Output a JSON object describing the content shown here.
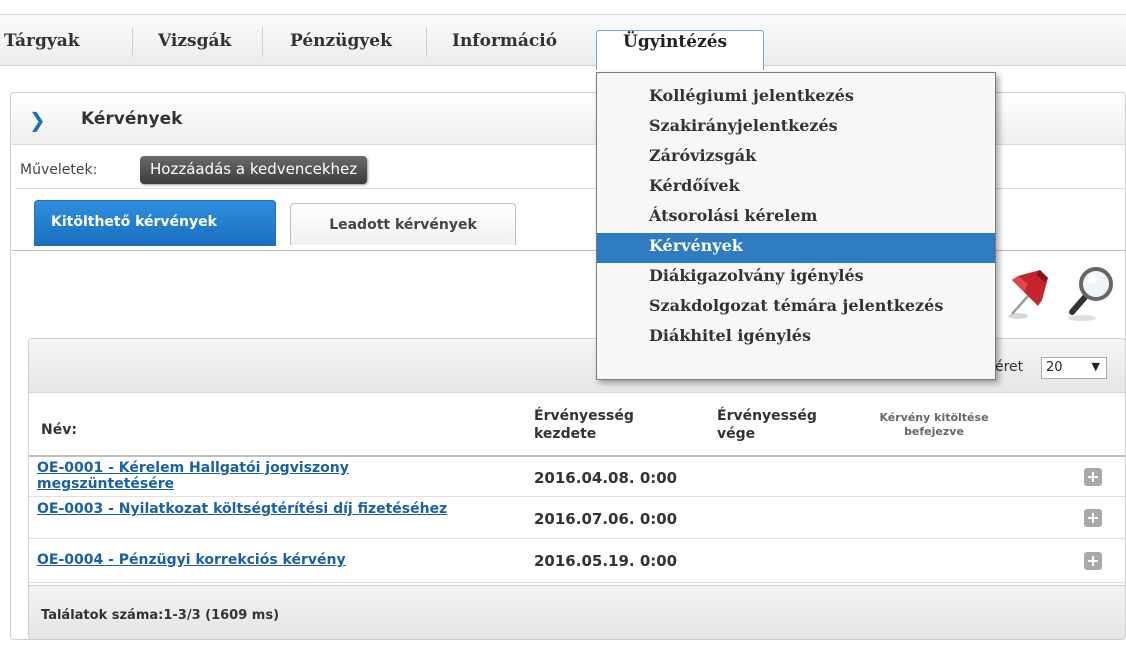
{
  "nav": {
    "items": [
      "Tárgyak",
      "Vizsgák",
      "Pénzügyek",
      "Információ"
    ],
    "active": "Ügyintézés"
  },
  "panel": {
    "title": "Kérvények",
    "ops_label": "Műveletek:",
    "fav_button": "Hozzáadás a kedvencekhez"
  },
  "tabs": {
    "active": "Kitölthető kérvények",
    "inactive": "Leadott kérvények"
  },
  "grid": {
    "page_size_label": "éret",
    "page_size": "20",
    "columns": {
      "name": "Név:",
      "start": "Érvényesség kezdete",
      "end": "Érvényesség vége",
      "done": "Kérvény kitöltése befejezve"
    },
    "rows": [
      {
        "name": "OE-0001 - Kérelem Hallgatói jogviszony megszüntetésére",
        "start": "2016.04.08. 0:00"
      },
      {
        "name": "OE-0003 - Nyilatkozat költségtérítési díj fizetéséhez",
        "start": "2016.07.06. 0:00"
      },
      {
        "name": "OE-0004 - Pénzügyi korrekciós kérvény",
        "start": "2016.05.19. 0:00"
      }
    ],
    "footer": "Találatok száma:1-3/3 (1609 ms)"
  },
  "menu": {
    "items": [
      "Kollégiumi jelentkezés",
      "Szakirányjelentkezés",
      "Záróvizsgák",
      "Kérdőívek",
      "Átsorolási kérelem",
      "Kérvények",
      "Diákigazolvány igénylés",
      "Szakdolgozat témára jelentkezés",
      "Diákhitel igénylés"
    ],
    "selected_index": 5,
    "highlight_color": "#2f7cc1"
  },
  "icons": [
    "pushpin-icon",
    "magnifier-icon",
    "plus-icon",
    "chevron-right-icon"
  ]
}
